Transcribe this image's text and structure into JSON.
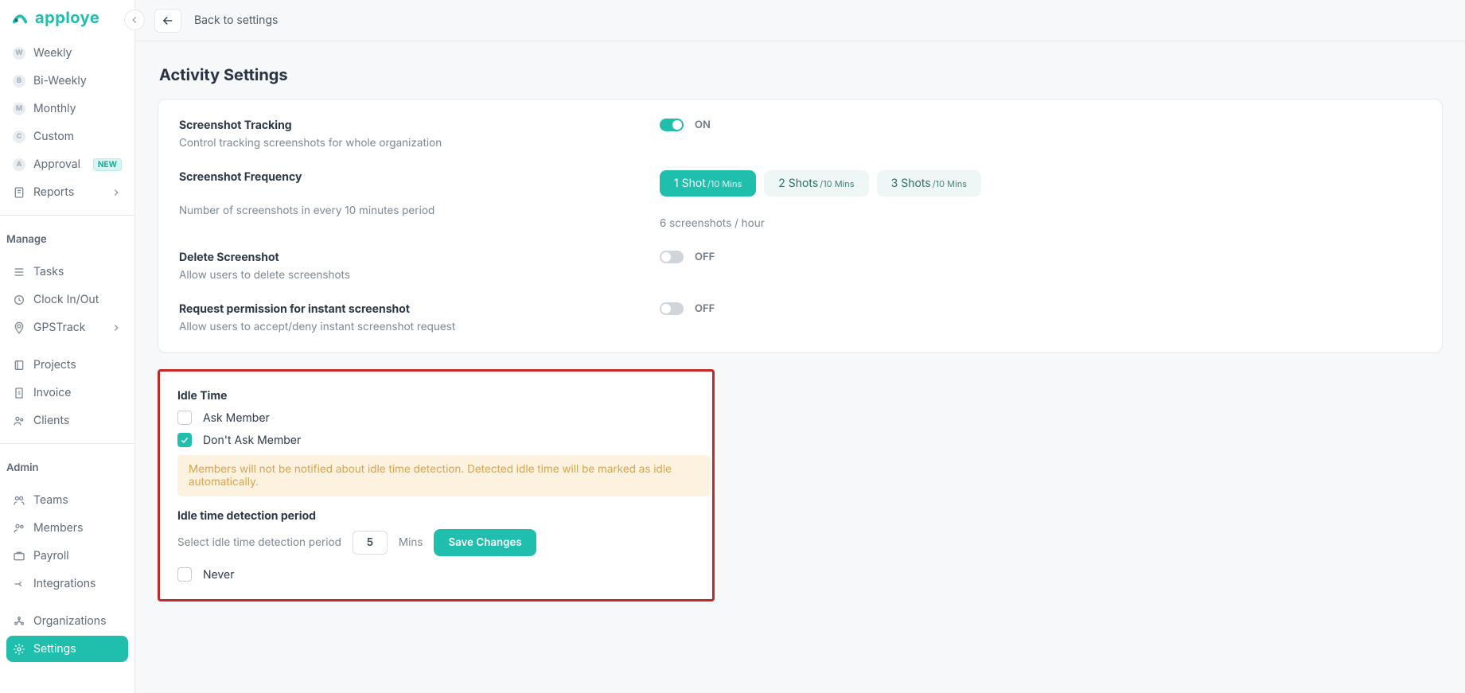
{
  "brand": {
    "name": "apploye"
  },
  "topbar": {
    "back_label": "Back to settings"
  },
  "sidebar": {
    "timesheet_items": [
      {
        "key": "W",
        "label": "Weekly"
      },
      {
        "key": "B",
        "label": "Bi-Weekly"
      },
      {
        "key": "M",
        "label": "Monthly"
      },
      {
        "key": "C",
        "label": "Custom"
      },
      {
        "key": "A",
        "label": "Approval",
        "badge": "NEW"
      }
    ],
    "reports_label": "Reports",
    "manage_label": "Manage",
    "manage_items": [
      {
        "label": "Tasks"
      },
      {
        "label": "Clock In/Out"
      },
      {
        "label": "GPSTrack",
        "chevron": true
      }
    ],
    "projects_label": "Projects",
    "invoice_label": "Invoice",
    "clients_label": "Clients",
    "admin_label": "Admin",
    "admin_items": [
      {
        "label": "Teams"
      },
      {
        "label": "Members"
      },
      {
        "label": "Payroll"
      },
      {
        "label": "Integrations"
      }
    ],
    "orgs_label": "Organizations",
    "settings_label": "Settings"
  },
  "page": {
    "title": "Activity Settings"
  },
  "tracking": {
    "title": "Screenshot Tracking",
    "sub": "Control tracking screenshots for whole organization",
    "state_label": "ON",
    "state_on": true
  },
  "frequency": {
    "title": "Screenshot Frequency",
    "sub": "Number of screenshots in every 10 minutes period",
    "options": [
      {
        "main": "1 Shot",
        "sub": "/10 Mins",
        "active": true
      },
      {
        "main": "2 Shots",
        "sub": "/10 Mins",
        "active": false
      },
      {
        "main": "3 Shots",
        "sub": "/10 Mins",
        "active": false
      }
    ],
    "hint": "6 screenshots / hour"
  },
  "delete_ss": {
    "title": "Delete Screenshot",
    "sub": "Allow users to delete screenshots",
    "state_label": "OFF"
  },
  "instant": {
    "title": "Request permission for instant screenshot",
    "sub": "Allow users to accept/deny instant screenshot request",
    "state_label": "OFF"
  },
  "idle": {
    "title": "Idle Time",
    "ask_label": "Ask Member",
    "dont_ask_label": "Don't Ask Member",
    "notice": "Members will not be notified about idle time detection. Detected idle time will be marked as idle automatically.",
    "period_title": "Idle time detection period",
    "period_sub": "Select idle time detection period",
    "value": "5",
    "unit": "Mins",
    "save_label": "Save Changes",
    "never_label": "Never"
  }
}
